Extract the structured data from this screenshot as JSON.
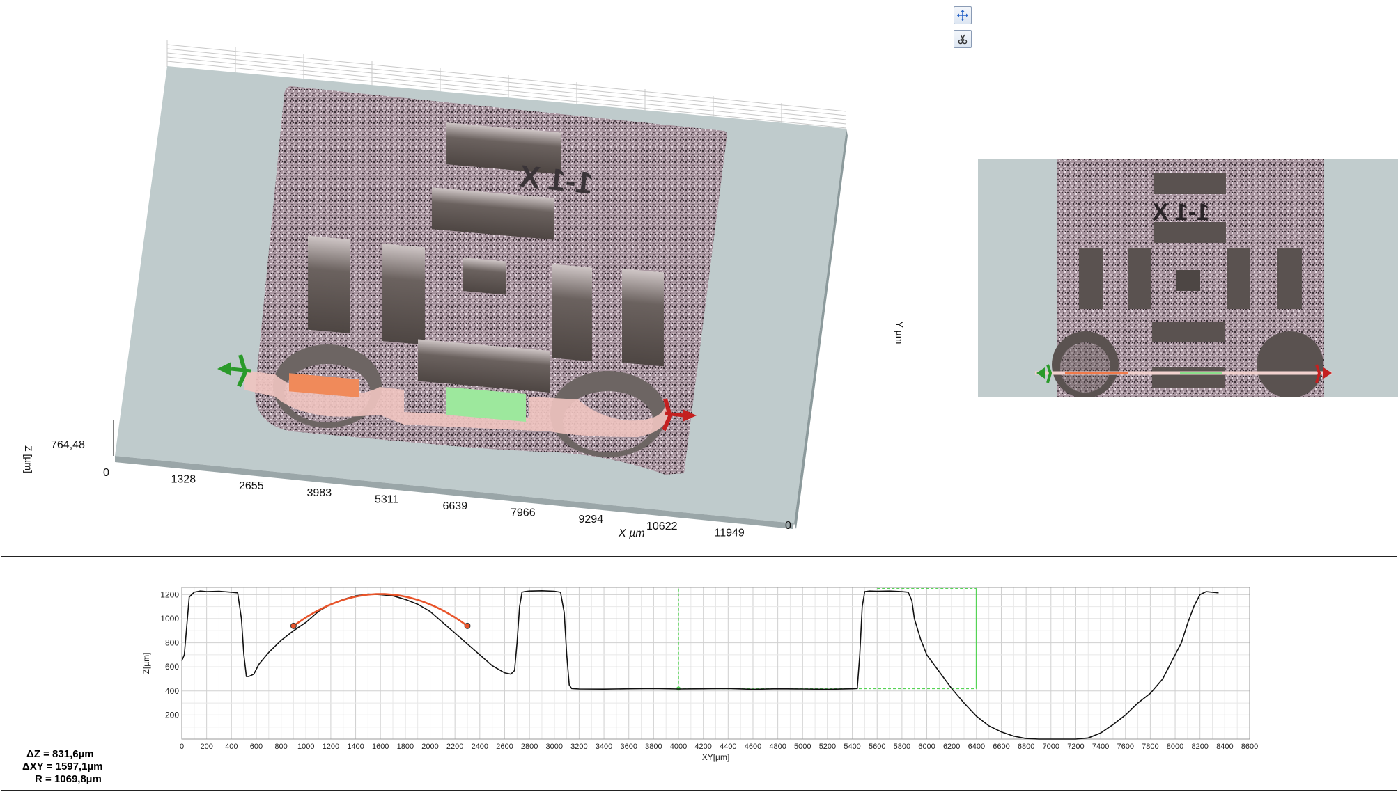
{
  "toolbar": {
    "buttons": [
      {
        "name": "pan-tool",
        "icon": "crosshair-move-icon"
      },
      {
        "name": "profile-tool",
        "icon": "scissors-icon"
      }
    ]
  },
  "view3d": {
    "z_axis_label": "Z [µm]",
    "z_max_label": "764,48",
    "x_axis_label": "X µm",
    "x_ticks": [
      "0",
      "1328",
      "2655",
      "3983",
      "5311",
      "6639",
      "7966",
      "9294",
      "10622",
      "11949"
    ],
    "x_end_label": "0"
  },
  "view2d": {
    "y_axis_label": "Y µm",
    "engraved_text": "1-1 X"
  },
  "profile": {
    "y_axis_label": "Z[µm]",
    "x_axis_label": "XY[µm]",
    "measurements": {
      "dz": "ΔZ = 831,6µm",
      "dxy": "ΔXY = 1597,1µm",
      "r": "R = 1069,8µm"
    },
    "colors": {
      "curve": "#111111",
      "arc": "#e8542a",
      "green": "#55d455"
    }
  },
  "chart_data": {
    "type": "line",
    "title": "",
    "xlabel": "XY[µm]",
    "ylabel": "Z[µm]",
    "xlim": [
      0,
      8600
    ],
    "ylim": [
      0,
      1260
    ],
    "x_ticks": [
      0,
      200,
      400,
      600,
      800,
      1000,
      1200,
      1400,
      1600,
      1800,
      2000,
      2200,
      2400,
      2600,
      2800,
      3000,
      3200,
      3400,
      3600,
      3800,
      4000,
      4200,
      4400,
      4600,
      4800,
      5000,
      5200,
      5400,
      5600,
      5800,
      6000,
      6200,
      6400,
      6600,
      6800,
      7000,
      7200,
      7400,
      7600,
      7800,
      8000,
      8200,
      8400,
      8600
    ],
    "y_ticks": [
      200,
      400,
      600,
      800,
      1000,
      1200
    ],
    "grid": true,
    "series": [
      {
        "x": [
          0,
          20,
          60,
          100,
          150,
          200,
          300,
          400,
          450,
          480,
          500,
          520,
          540,
          580,
          620,
          700,
          800,
          900,
          1000,
          1100,
          1200,
          1300,
          1400,
          1500,
          1600,
          1700,
          1800,
          1900,
          2000,
          2100,
          2200,
          2300,
          2400,
          2500,
          2600,
          2650,
          2680,
          2700,
          2720,
          2740,
          2760,
          2800,
          2900,
          3000,
          3050,
          3080,
          3100,
          3120,
          3140,
          3170,
          3200,
          3400,
          3600,
          3800,
          4000,
          4200,
          4400,
          4600,
          4800,
          5000,
          5200,
          5400,
          5440,
          5460,
          5480,
          5500,
          5540,
          5600,
          5700,
          5800,
          5850,
          5880,
          5900,
          5950,
          6000,
          6100,
          6200,
          6300,
          6400,
          6500,
          6600,
          6700,
          6800,
          6900,
          7000,
          7100,
          7200,
          7300,
          7400,
          7500,
          7600,
          7700,
          7800,
          7900,
          8000,
          8050,
          8100,
          8150,
          8200,
          8250,
          8300,
          8350
        ],
        "y": [
          650,
          700,
          1180,
          1220,
          1230,
          1225,
          1228,
          1220,
          1215,
          1000,
          700,
          520,
          520,
          540,
          620,
          720,
          820,
          900,
          970,
          1060,
          1120,
          1160,
          1190,
          1205,
          1200,
          1190,
          1160,
          1120,
          1060,
          970,
          880,
          790,
          700,
          610,
          550,
          540,
          570,
          800,
          1100,
          1220,
          1225,
          1230,
          1232,
          1228,
          1220,
          1050,
          700,
          450,
          420,
          418,
          416,
          415,
          418,
          420,
          416,
          418,
          420,
          414,
          418,
          416,
          414,
          418,
          420,
          700,
          1100,
          1225,
          1230,
          1228,
          1230,
          1225,
          1220,
          1150,
          1000,
          830,
          700,
          560,
          420,
          300,
          190,
          110,
          60,
          25,
          5,
          0,
          0,
          0,
          0,
          10,
          50,
          120,
          200,
          300,
          380,
          500,
          700,
          800,
          960,
          1100,
          1200,
          1225,
          1220,
          1215
        ]
      }
    ],
    "annotations": {
      "arc_fit": {
        "x_from": 900,
        "x_to": 2300,
        "apex_x": 1600,
        "apex_y": 1205,
        "end_y": 940
      },
      "green_region": {
        "x_from": 4000,
        "x_to": 6400,
        "y_low": 420,
        "y_high": 1250
      }
    }
  }
}
